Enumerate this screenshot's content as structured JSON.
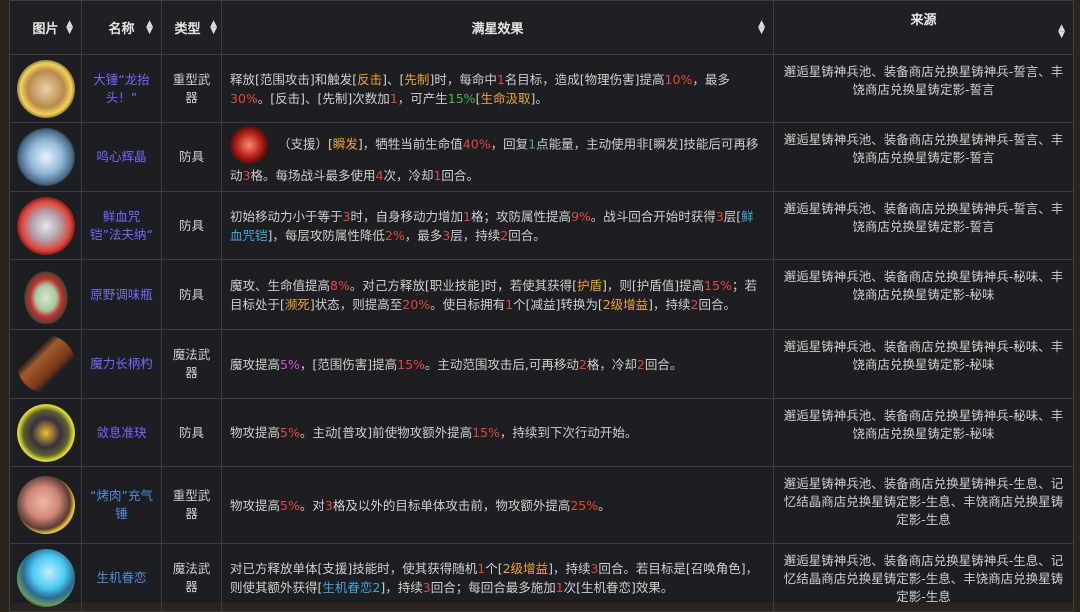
{
  "headers": {
    "image": "图片",
    "name": "名称",
    "type": "类型",
    "effect": "满星效果",
    "source": "来源"
  },
  "colors": {
    "r": "#e8453a",
    "o": "#f0a429",
    "g": "#45b94a",
    "b": "#3fa8dc",
    "p": "#d54bd8"
  },
  "rows": [
    {
      "name": "大锤“龙抬头！”",
      "type": "重型武器",
      "icon": "hammer-item-icon",
      "desc": [
        [
          "释放[范围攻击]和触发[",
          "n"
        ],
        [
          "反击",
          "o"
        ],
        [
          "]、[",
          "n"
        ],
        [
          "先制",
          "o"
        ],
        [
          "]时，每命中",
          "n"
        ],
        [
          "1",
          "r"
        ],
        [
          "名目标，造成[物理伤害]提高",
          "n"
        ],
        [
          "10%",
          "r"
        ],
        [
          "，最多",
          "n"
        ],
        [
          "30%",
          "r"
        ],
        [
          "。[反击]、[先制]次数加",
          "n"
        ],
        [
          "1",
          "r"
        ],
        [
          "，可产生",
          "n"
        ],
        [
          "15%",
          "g"
        ],
        [
          "[",
          "n"
        ],
        [
          "生命汲取",
          "o"
        ],
        [
          "]。",
          "n"
        ]
      ],
      "source": "邂逅星铸神兵池、装备商店兑换星铸神兵-誓言、丰饶商店兑换星铸定影-誓言"
    },
    {
      "name": "鸣心辉晶",
      "type": "防具",
      "icon": "crystal-item-icon",
      "skill_icon": true,
      "desc": [
        [
          "（支援）[",
          "n"
        ],
        [
          "瞬发",
          "o"
        ],
        [
          "]，牺牲当前生命值",
          "n"
        ],
        [
          "40%",
          "r"
        ],
        [
          "，回复",
          "n"
        ],
        [
          "1",
          "g"
        ],
        [
          "点能量，主动使用非[瞬发]技能后可再移动",
          "n"
        ],
        [
          "3",
          "r"
        ],
        [
          "格。每场战斗最多使用",
          "n"
        ],
        [
          "4",
          "r"
        ],
        [
          "次，冷却",
          "n"
        ],
        [
          "1",
          "r"
        ],
        [
          "回合。",
          "n"
        ]
      ],
      "source": "邂逅星铸神兵池、装备商店兑换星铸神兵-誓言、丰饶商店兑换星铸定影-誓言"
    },
    {
      "name": "鲜血咒铠”法夫纳“",
      "type": "防具",
      "icon": "armor-item-icon",
      "desc": [
        [
          "初始移动力小于等于",
          "n"
        ],
        [
          "3",
          "r"
        ],
        [
          "时，自身移动力增加",
          "n"
        ],
        [
          "1",
          "r"
        ],
        [
          "格；攻防属性提高",
          "n"
        ],
        [
          "9%",
          "r"
        ],
        [
          "。战斗回合开始时获得",
          "n"
        ],
        [
          "3",
          "r"
        ],
        [
          "层[",
          "n"
        ],
        [
          "鲜血咒铠",
          "b"
        ],
        [
          "]，每层攻防属性降低",
          "n"
        ],
        [
          "2%",
          "r"
        ],
        [
          "，最多",
          "n"
        ],
        [
          "3",
          "r"
        ],
        [
          "层，持续",
          "n"
        ],
        [
          "2",
          "r"
        ],
        [
          "回合。",
          "n"
        ]
      ],
      "source": "邂逅星铸神兵池、装备商店兑换星铸神兵-誓言、丰饶商店兑换星铸定影-誓言"
    },
    {
      "name": "原野调味瓶",
      "type": "防具",
      "icon": "bottle-item-icon",
      "desc": [
        [
          "魔攻、生命值提高",
          "n"
        ],
        [
          "8%",
          "r"
        ],
        [
          "。对己方释放[职业技能]时，若使其获得[",
          "n"
        ],
        [
          "护盾",
          "o"
        ],
        [
          "]，则[护盾值]提高",
          "n"
        ],
        [
          "15%",
          "r"
        ],
        [
          "；若目标处于[",
          "n"
        ],
        [
          "濒死",
          "o"
        ],
        [
          "]状态，则提高至",
          "n"
        ],
        [
          "20%",
          "r"
        ],
        [
          "。使目标拥有",
          "n"
        ],
        [
          "1",
          "r"
        ],
        [
          "个[减益]转换为[",
          "n"
        ],
        [
          "2级增益",
          "o"
        ],
        [
          "]，持续",
          "n"
        ],
        [
          "2",
          "r"
        ],
        [
          "回合。",
          "n"
        ]
      ],
      "source": "邂逅星铸神兵池、装备商店兑换星铸神兵-秘味、丰饶商店兑换星铸定影-秘味"
    },
    {
      "name": "魔力长柄杓",
      "type": "魔法武器",
      "icon": "ladle-item-icon",
      "desc": [
        [
          "魔攻提高",
          "n"
        ],
        [
          "5%",
          "p"
        ],
        [
          "，[范围伤害]提高",
          "n"
        ],
        [
          "15%",
          "r"
        ],
        [
          "。主动范围攻击后,可再移动",
          "n"
        ],
        [
          "2",
          "r"
        ],
        [
          "格，冷却",
          "n"
        ],
        [
          "2",
          "r"
        ],
        [
          "回合。",
          "n"
        ]
      ],
      "source": "邂逅星铸神兵池、装备商店兑换星铸神兵-秘味、丰饶商店兑换星铸定影-秘味"
    },
    {
      "name": "敛息准玦",
      "type": "防具",
      "icon": "jade-item-icon",
      "desc": [
        [
          "物攻提高",
          "n"
        ],
        [
          "5%",
          "r"
        ],
        [
          "。主动[普攻]前使物攻额外提高",
          "n"
        ],
        [
          "15%",
          "r"
        ],
        [
          "，持续到下次行动开始。",
          "n"
        ]
      ],
      "source": "邂逅星铸神兵池、装备商店兑换星铸神兵-秘味、丰饶商店兑换星铸定影-秘味"
    },
    {
      "name": "“烤肉”充气锤",
      "type": "重型武器",
      "icon": "pig-hammer-item-icon",
      "desc": [
        [
          "物攻提高",
          "n"
        ],
        [
          "5%",
          "r"
        ],
        [
          "。对",
          "n"
        ],
        [
          "3",
          "r"
        ],
        [
          "格及以外的目标单体攻击前，物攻额外提高",
          "n"
        ],
        [
          "25%",
          "r"
        ],
        [
          "。",
          "n"
        ]
      ],
      "source": "邂逅星铸神兵池、装备商店兑换星铸神兵-生息、记忆结晶商店兑换星铸定影-生息、丰饶商店兑换星铸定影-生息"
    },
    {
      "name": "生机眷恋",
      "type": "魔法武器",
      "icon": "flower-item-icon",
      "desc": [
        [
          "对已方释放单体[支援]技能时，使其获得随机",
          "n"
        ],
        [
          "1",
          "r"
        ],
        [
          "个[",
          "n"
        ],
        [
          "2级增益",
          "o"
        ],
        [
          "]，持续",
          "n"
        ],
        [
          "3",
          "r"
        ],
        [
          "回合。若目标是[召唤角色]，则使其额外获得[",
          "n"
        ],
        [
          "生机眷恋2",
          "b"
        ],
        [
          "]，持续",
          "n"
        ],
        [
          "3",
          "r"
        ],
        [
          "回合；每回合最多施加",
          "n"
        ],
        [
          "1",
          "r"
        ],
        [
          "次[生机眷恋]效果。",
          "n"
        ]
      ],
      "source": "邂逅星铸神兵池、装备商店兑换星铸神兵-生息、记忆结晶商店兑换星铸定影-生息、丰饶商店兑换星铸定影-生息"
    }
  ]
}
